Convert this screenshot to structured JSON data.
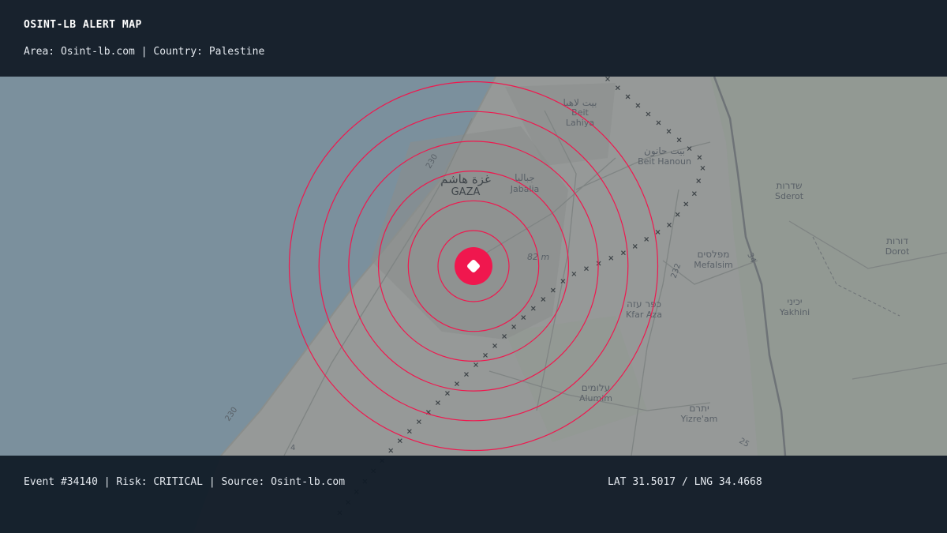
{
  "header": {
    "title": "OSINT-LB ALERT MAP",
    "area_label": "Area:",
    "area_value": "Osint-lb.com",
    "country_label": "Country:",
    "country_value": "Palestine"
  },
  "footer": {
    "event": "Event #34140",
    "risk_label": "Risk:",
    "risk_value": "CRITICAL",
    "source_label": "Source:",
    "source_value": "Osint-lb.com",
    "lat_label": "LAT",
    "lat_value": "31.5017",
    "lng_label": "LNG",
    "lng_value": "34.4668"
  },
  "map": {
    "place_labels": [
      {
        "native": "بيت لاهيا",
        "latin": "Beit Lahiya"
      },
      {
        "native": "بيت حانون",
        "latin": "Beit Hanoun"
      },
      {
        "native": "غزة هاشم",
        "latin": "GAZA"
      },
      {
        "native": "جباليا",
        "latin": "Jabalia"
      },
      {
        "native": "שדרות",
        "latin": "Sderot"
      },
      {
        "native": "דורות",
        "latin": "Dorot"
      },
      {
        "native": "מפלסים",
        "latin": "Mefalsim"
      },
      {
        "native": "כפר עזה",
        "latin": "Kfar Aza"
      },
      {
        "native": "יכיני",
        "latin": "Yakhini"
      },
      {
        "native": "עלומים",
        "latin": "Alumim"
      },
      {
        "native": "יתרם",
        "latin": "Yizre'am"
      }
    ],
    "road_labels": [
      "230",
      "232",
      "34",
      "230",
      "4",
      "25"
    ],
    "elevation_label": "82 m",
    "ring_count": 6
  },
  "colors": {
    "sea": "#7b909d",
    "land": "#969998",
    "alert": "#f0174e",
    "banner": "#101b26"
  }
}
